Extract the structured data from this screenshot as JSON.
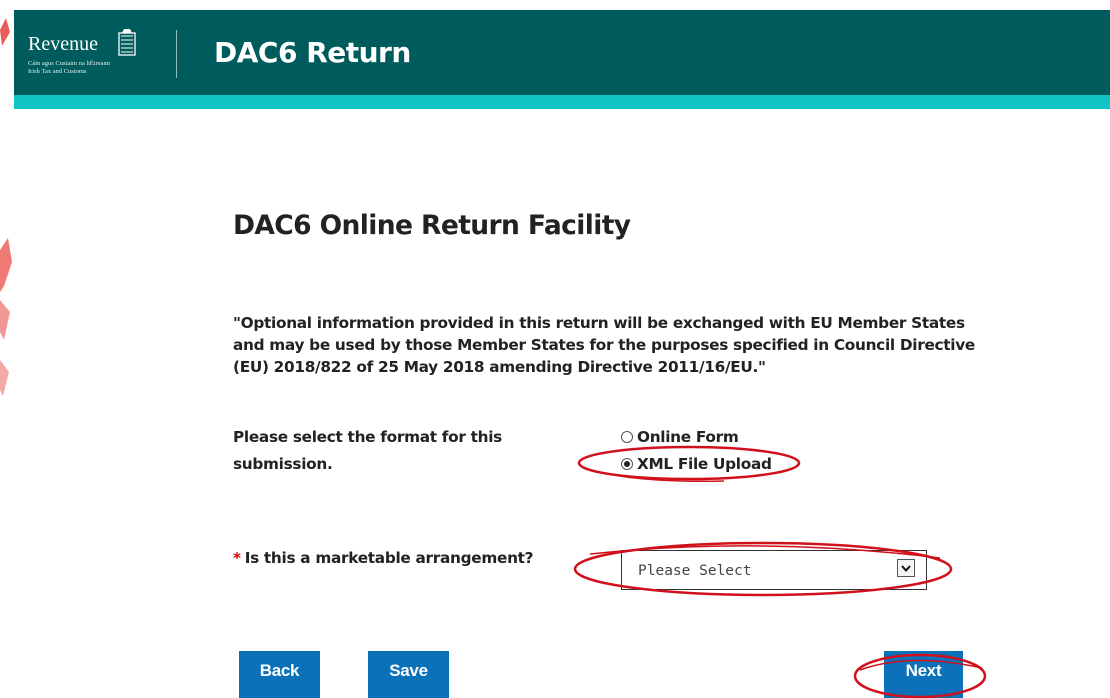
{
  "header": {
    "logo_word": "Revenue",
    "logo_line1": "Cáin agus Custaim na hÉireann",
    "logo_line2": "Irish Tax and Customs",
    "title": "DAC6 Return"
  },
  "main": {
    "title": "DAC6 Online Return Facility",
    "notice": "\"Optional information provided in this return will be exchanged with EU Member States and may be used by those Member States for the purposes specified in Council Directive (EU) 2018/822 of 25 May 2018 amending Directive 2011/16/EU.\""
  },
  "format": {
    "label": "Please select the format for this submission.",
    "options": [
      {
        "label": "Online Form",
        "checked": false
      },
      {
        "label": "XML File Upload",
        "checked": true
      }
    ]
  },
  "marketable": {
    "required_marker": "*",
    "label": "Is this a marketable arrangement?",
    "selected": "Please Select"
  },
  "buttons": {
    "back": "Back",
    "save": "Save",
    "next": "Next"
  },
  "colors": {
    "header_bg": "#005c5c",
    "header_accent": "#11c4c4",
    "button_bg": "#0b71b9",
    "annotation_red": "#d0101a"
  }
}
